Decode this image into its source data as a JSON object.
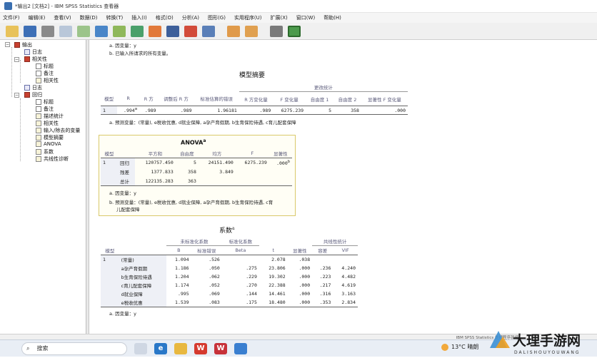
{
  "window": {
    "title": "*输出2 [文档2] - IBM SPSS Statistics 查看器"
  },
  "menu": [
    "文件(F)",
    "编辑(E)",
    "查看(V)",
    "数据(D)",
    "转换(T)",
    "插入(I)",
    "格式(O)",
    "分析(A)",
    "图形(G)",
    "实用程序(U)",
    "扩展(X)",
    "窗口(W)",
    "帮助(H)"
  ],
  "tree": [
    {
      "label": "输出",
      "icon": "book-icon"
    },
    {
      "label": "日志",
      "icon": "log-icon"
    },
    {
      "label": "相关性",
      "icon": "book-icon"
    },
    {
      "label": "标题",
      "icon": "title-icon"
    },
    {
      "label": "备注",
      "icon": "notes-icon"
    },
    {
      "label": "相关性",
      "icon": "table-icon"
    },
    {
      "label": "日志",
      "icon": "log-icon"
    },
    {
      "label": "回归",
      "icon": "book-icon"
    },
    {
      "label": "标题",
      "icon": "title-icon"
    },
    {
      "label": "备注",
      "icon": "notes-icon"
    },
    {
      "label": "描述统计",
      "icon": "table-icon"
    },
    {
      "label": "相关性",
      "icon": "table-icon"
    },
    {
      "label": "输入/除去的变量",
      "icon": "table-icon"
    },
    {
      "label": "模型摘要",
      "icon": "table-icon"
    },
    {
      "label": "ANOVA",
      "icon": "table-icon"
    },
    {
      "label": "系数",
      "icon": "table-icon"
    },
    {
      "label": "共线性诊断",
      "icon": "table-icon"
    }
  ],
  "top_notes": [
    "a. 因变量：y",
    "b. 已输入所请求的所有变量。"
  ],
  "model_summary": {
    "title": "模型摘要",
    "group_header": "更改统计",
    "headers": [
      "模型",
      "R",
      "R 方",
      "调整后 R 方",
      "标准估算的错误",
      "R 方变化量",
      "F 变化量",
      "自由度 1",
      "自由度 2",
      "显著性 F 变化量"
    ],
    "row": [
      "1",
      ".994",
      "a",
      ".989",
      ".989",
      "1.96181",
      ".989",
      "6275.239",
      "5",
      "358",
      ".000"
    ],
    "footnote": "a. 预测变量：(常量), e税收优惠, d就业保障, a孕产育假期, b生育保险待遇, c育儿配套保障"
  },
  "anova": {
    "title": "ANOVA",
    "title_sup": "a",
    "headers": [
      "模型",
      "",
      "平方和",
      "自由度",
      "均方",
      "F",
      "显著性"
    ],
    "rows": [
      [
        "1",
        "回归",
        "120757.450",
        "5",
        "24151.490",
        "6275.239",
        ".000",
        "b"
      ],
      [
        "",
        "残差",
        "1377.833",
        "358",
        "3.849",
        "",
        "",
        ""
      ],
      [
        "",
        "总计",
        "122135.283",
        "363",
        "",
        "",
        "",
        ""
      ]
    ],
    "footnote_a": "a. 因变量：y",
    "footnote_b1": "b. 预测变量：(常量), e税收优惠, d就业保障, a孕产育假期, b生育保险待遇, c育",
    "footnote_b2": "儿配套保障"
  },
  "coefficients": {
    "title": "系数",
    "title_sup": "a",
    "group_unstd": "未标准化系数",
    "group_std": "标准化系数",
    "group_col": "共线性统计",
    "headers": [
      "模型",
      "",
      "B",
      "标准错误",
      "Beta",
      "t",
      "显著性",
      "容差",
      "VIF"
    ],
    "rows": [
      [
        "1",
        "(常量)",
        "1.094",
        ".526",
        "",
        "2.078",
        ".038",
        "",
        ""
      ],
      [
        "",
        "a孕产育假期",
        "1.186",
        ".050",
        ".275",
        "23.806",
        ".000",
        ".236",
        "4.240"
      ],
      [
        "",
        "b生育保险待遇",
        "1.204",
        ".062",
        ".229",
        "19.302",
        ".000",
        ".223",
        "4.482"
      ],
      [
        "",
        "c育儿配套保障",
        "1.174",
        ".052",
        ".270",
        "22.388",
        ".000",
        ".217",
        "4.619"
      ],
      [
        "",
        "d就业保障",
        ".995",
        ".069",
        ".144",
        "14.461",
        ".000",
        ".316",
        "3.163"
      ],
      [
        "",
        "e税收优惠",
        "1.539",
        ".083",
        ".175",
        "18.480",
        ".000",
        ".353",
        "2.834"
      ]
    ],
    "footnote": "a. 因变量：y"
  },
  "status": {
    "text": "IBM SPSS Statistics 处理程序就绪"
  },
  "taskbar": {
    "search": "搜索",
    "weather_temp": "13°C",
    "weather_desc": "晴朗"
  },
  "watermark": {
    "text": "大理手游网",
    "sub": "DALISHOUYOUWANG"
  },
  "colors": {
    "frame_highlight": "#d9c96a",
    "header_text": "#5a5a7a",
    "tree_book": "#c8402f"
  }
}
